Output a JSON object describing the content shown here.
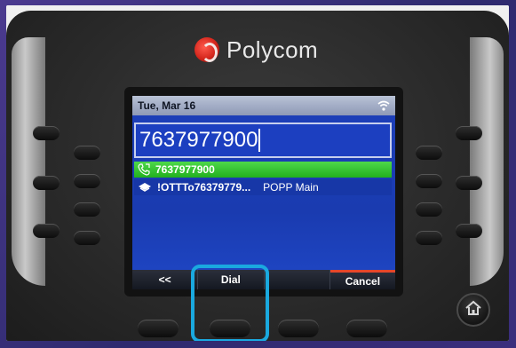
{
  "phone": {
    "brand": "Polycom"
  },
  "screen": {
    "status": {
      "date": "Tue, Mar 16"
    },
    "dial_input": {
      "value": "7637977900"
    },
    "suggestions": [
      {
        "primary": "7637977900",
        "secondary": "",
        "icon": "handset-icon",
        "selected": true
      },
      {
        "primary": "!OTTTo76379779...",
        "secondary": "POPP Main",
        "icon": "directory-icon",
        "selected": false
      }
    ],
    "softkeys": [
      {
        "label": "<<"
      },
      {
        "label": "Dial"
      },
      {
        "label": ""
      },
      {
        "label": "Cancel"
      }
    ]
  },
  "colors": {
    "highlight": "#1aa9df",
    "selected_row": "#22b01e",
    "screen_blue": "#1a3bb0",
    "cancel_accent": "#e5462b"
  }
}
